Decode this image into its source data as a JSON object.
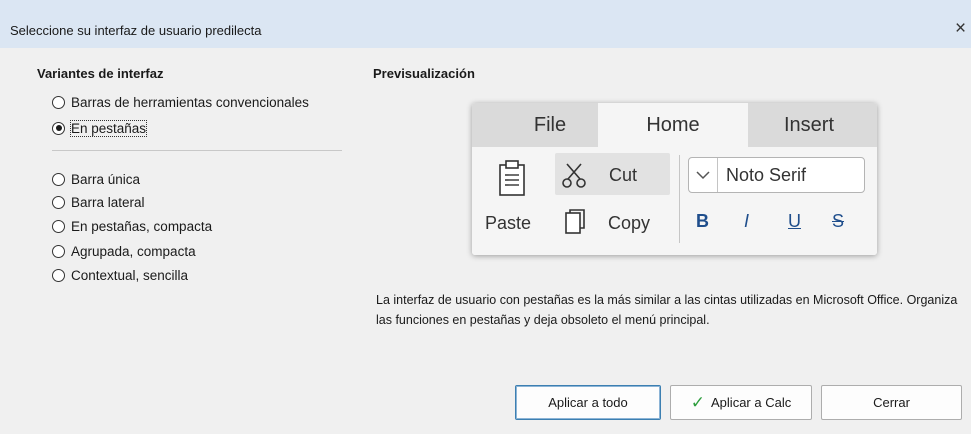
{
  "window": {
    "title": "Seleccione su interfaz de usuario predilecta",
    "close_glyph": "×"
  },
  "variants": {
    "heading": "Variantes de interfaz",
    "options": [
      {
        "label": "Barras de herramientas convencionales",
        "checked": false
      },
      {
        "label": "En pestañas",
        "checked": true
      },
      {
        "label": "Barra única",
        "checked": false
      },
      {
        "label": "Barra lateral",
        "checked": false
      },
      {
        "label": "En pestañas, compacta",
        "checked": false
      },
      {
        "label": "Agrupada, compacta",
        "checked": false
      },
      {
        "label": "Contextual, sencilla",
        "checked": false
      }
    ]
  },
  "preview": {
    "heading": "Previsualización",
    "tabs": [
      "File",
      "Home",
      "Insert"
    ],
    "active_tab": "Home",
    "cut": "Cut",
    "copy": "Copy",
    "paste": "Paste",
    "font": "Noto Serif",
    "bold": "B",
    "italic": "I",
    "underline": "U",
    "strike": "S"
  },
  "description": "La interfaz de usuario con pestañas es la más similar a las cintas utilizadas en Microsoft Office. Organiza las funciones en pestañas y deja obsoleto el menú principal.",
  "buttons": {
    "apply_all": "Aplicar a todo",
    "apply_calc": "Aplicar a Calc",
    "close": "Cerrar"
  },
  "colors": {
    "titlebar": "#dbe6f3",
    "dialog": "#f0f0f0",
    "check": "#2e9e3e",
    "format_buttons": "#1f4e8c"
  }
}
